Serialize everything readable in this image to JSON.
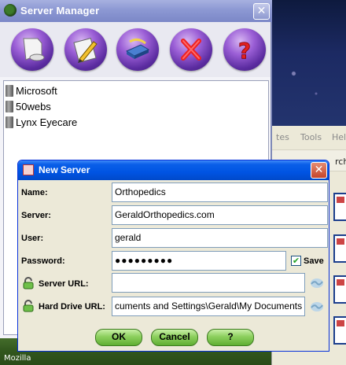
{
  "server_manager": {
    "title": "Server Manager",
    "toolbar": [
      {
        "icon": "new-document-icon"
      },
      {
        "icon": "edit-icon"
      },
      {
        "icon": "connect-icon"
      },
      {
        "icon": "delete-icon"
      },
      {
        "icon": "help-icon"
      }
    ],
    "servers": [
      "Microsoft",
      "50webs",
      "Lynx Eyecare"
    ]
  },
  "background": {
    "menu": {
      "tools": "Tools",
      "help": "Help",
      "partial": "tes"
    },
    "toolbar_text": "rch",
    "status_text": "Mozilla"
  },
  "dialog": {
    "title": "New Server",
    "name_label": "Name:",
    "name_value": "Orthopedics",
    "server_label": "Server:",
    "server_value": "GeraldOrthopedics.com",
    "user_label": "User:",
    "user_value": "gerald",
    "password_label": "Password:",
    "password_value": "●●●●●●●●●",
    "save_label": "Save",
    "save_checked": true,
    "server_url_label": "Server URL:",
    "server_url_value": "",
    "hard_drive_label": "Hard Drive URL:",
    "hard_drive_value": "cuments and Settings\\Gerald\\My Documents",
    "buttons": {
      "ok": "OK",
      "cancel": "Cancel",
      "help": "?"
    }
  },
  "colors": {
    "xp_blue": "#0054e3",
    "purple": "#9b5fd6",
    "green_button": "#8ccf5d"
  }
}
